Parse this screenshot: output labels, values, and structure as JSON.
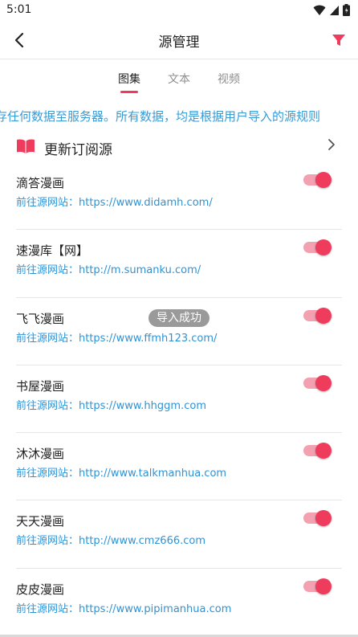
{
  "status": {
    "time": "5:01"
  },
  "app_bar": {
    "title": "源管理"
  },
  "tabs": [
    {
      "label": "图集",
      "active": true
    },
    {
      "label": "文本",
      "active": false
    },
    {
      "label": "视频",
      "active": false
    }
  ],
  "notice": "存任何数据至服务器。所有数据，均是根据用户导入的源规则",
  "update": {
    "label": "更新订阅源"
  },
  "sources": [
    {
      "name": "滴答漫画",
      "link": "前往源网站：https://www.didamh.com/",
      "enabled": true
    },
    {
      "name": "速漫库【网】",
      "link": "前往源网站：http://m.sumanku.com/",
      "enabled": true
    },
    {
      "name": "飞飞漫画",
      "link": "前往源网站：https://www.ffmh123.com/",
      "enabled": true
    },
    {
      "name": "书屋漫画",
      "link": "前往源网站：https://www.hhggm.com",
      "enabled": true
    },
    {
      "name": "沐沐漫画",
      "link": "前往源网站：http://www.talkmanhua.com",
      "enabled": true
    },
    {
      "name": "天天漫画",
      "link": "前往源网站：http://www.cmz666.com",
      "enabled": true
    },
    {
      "name": "皮皮漫画",
      "link": "前往源网站：https://www.pipimanhua.com",
      "enabled": true
    }
  ],
  "toast": "导入成功",
  "colors": {
    "accent": "#ef3b5c",
    "link": "#2e93d6",
    "notice": "#3a9bd5"
  }
}
